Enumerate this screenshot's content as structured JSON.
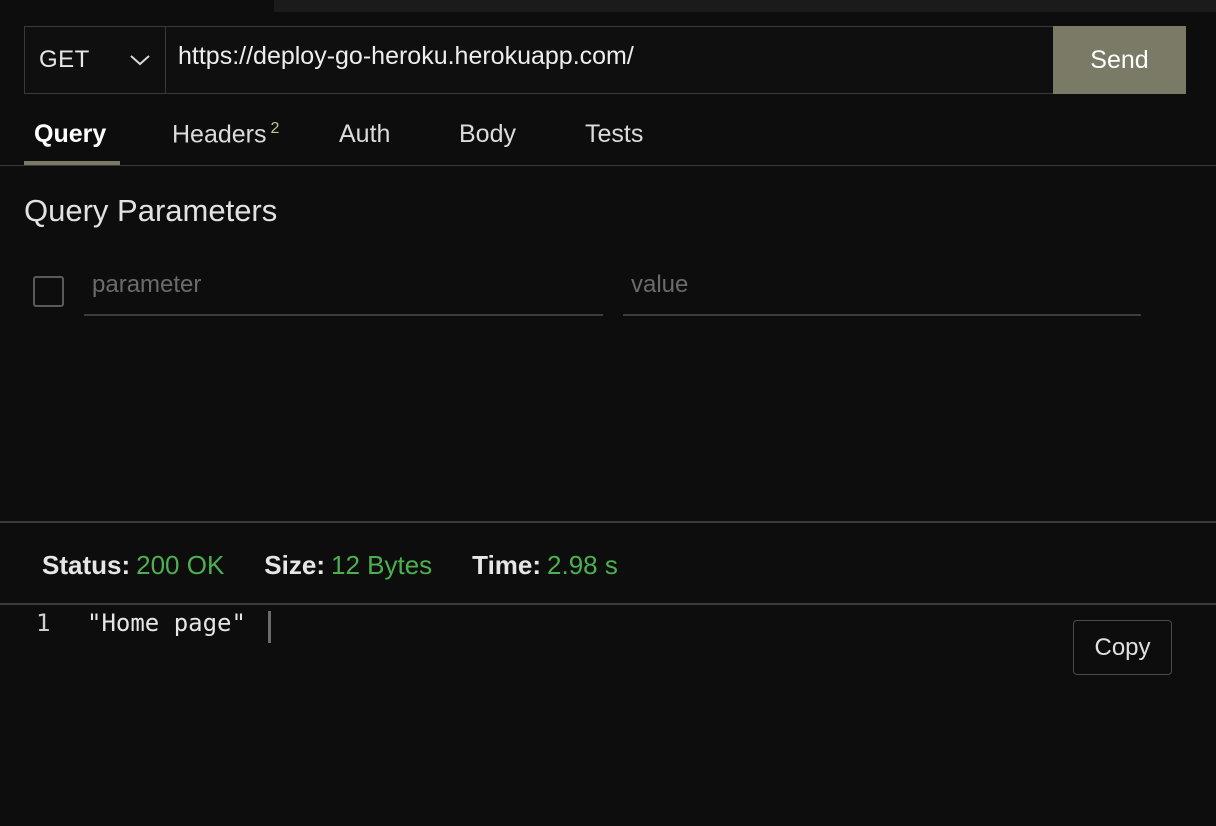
{
  "request": {
    "method": "GET",
    "url": "https://deploy-go-heroku.herokuapp.com/",
    "send_label": "Send"
  },
  "tabs": [
    {
      "label": "Query",
      "active": true
    },
    {
      "label": "Headers",
      "badge": "2"
    },
    {
      "label": "Auth"
    },
    {
      "label": "Body"
    },
    {
      "label": "Tests"
    }
  ],
  "query": {
    "title": "Query Parameters",
    "param_placeholder": "parameter",
    "value_placeholder": "value"
  },
  "response": {
    "status_label": "Status:",
    "status_value": "200 OK",
    "size_label": "Size:",
    "size_value": "12 Bytes",
    "time_label": "Time:",
    "time_value": "2.98 s",
    "line_number": "1",
    "body": "\"Home page\"",
    "copy_label": "Copy"
  },
  "colors": {
    "accent": "#7a7a67",
    "success": "#4caf50",
    "background": "#0d0d0d"
  }
}
